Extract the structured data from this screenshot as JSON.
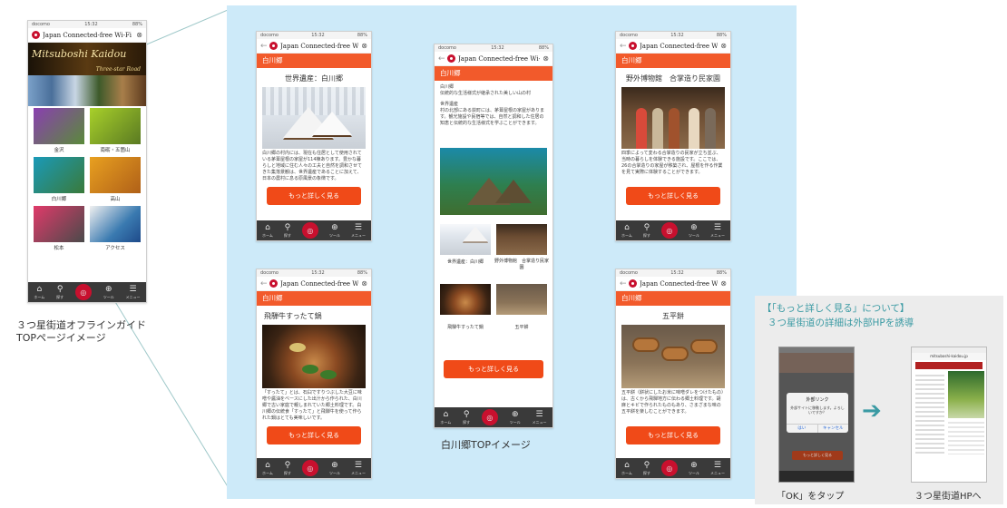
{
  "status_bar": {
    "carrier": "docomo",
    "time": "15:32",
    "battery": "88%"
  },
  "app": {
    "title": "Japan Connected-free Wi-Fi",
    "more_label": "もっと詳しく見る"
  },
  "tabbar": {
    "home": "ホーム",
    "search": "探す",
    "center": "宿泊",
    "tools": "ツール",
    "menu": "メニュー"
  },
  "guide": {
    "banner_title": "Mitsuboshi Kaidou",
    "banner_sub": "Three-star Road",
    "tiles": [
      "金沢",
      "南砺・五箇山",
      "白川郷",
      "高山",
      "松本",
      "アクセス"
    ],
    "caption_line1": "３つ星街道オフラインガイド",
    "caption_line2": "TOPページイメージ"
  },
  "shirakawa_top": {
    "crumb": "白川郷",
    "heading": "白川郷",
    "subheading": "伝統的な生活様式が継承された美しい山の村",
    "body_title": "世界遺産",
    "body": "村の北部にある荻町には、茅葺屋根の家屋があります。観光施設や民宿等では、自然と調和した住居の知恵と伝統的な生活様式を学ぶことができます。",
    "thumbs": [
      "世界遺産：白川郷",
      "野外博物館　合掌造り民家園",
      "飛騨牛すったて鍋",
      "五平餅"
    ],
    "caption": "白川郷TOPイメージ"
  },
  "pages": {
    "world_heritage": {
      "crumb": "白川郷",
      "title": "世界遺産：白川郷",
      "text": "白川郷の村内には、現在も住居として使用されている茅葺屋根の家屋が114棟あります。豊かな暮らしと地域に住む人々の工夫と自然を調和させてきた集落景観は、世界遺産であることに加えて、日本の農村に息る原風景の象徴です。"
    },
    "museum": {
      "crumb": "白川郷",
      "title": "野外博物館　合掌造り民家園",
      "text": "四季によって変わる合掌造りの民家が立ち並ぶ、当時の暮らしを体験できる施設です。ここでは、26の合掌造りの家屋が移築され、屋根を作る作業を見て実際に体験することができます。"
    },
    "nabe": {
      "crumb": "白川郷",
      "title": "飛騨牛すったて鍋",
      "text": "「すったて」とは、石臼ですりつぶした大豆に味噌や醤油をベースにした出汁から作られた、白川郷で古い家庭で親しまれていた郷土料理です。白川郷の伝統食「すったて」と飛騨牛を使って作られた鍋はとても美味しいです。"
    },
    "gohei": {
      "crumb": "白川郷",
      "title": "五平餅",
      "text": "五平餅（餅状にしたお米に味噌ダレをつけたもの）は、古くから飛騨地方に伝わる郷土料理です。胡麻とキビで作られたものもあり、さまざまな味の五平餅を楽しむことができます。"
    }
  },
  "note": {
    "title": "【「もっと詳しく見る」について】",
    "subtitle": "３つ星街道の詳細は外部HPを誘導",
    "dialog_title": "外部リンク",
    "dialog_body": "外部サイトに移動します。よろしいですか？",
    "dialog_ok": "はい",
    "dialog_cancel": "キャンセル",
    "caption_left": "「OK」をタップ",
    "caption_right": "３つ星街道HPへ",
    "url": "mitsuboshi-kaidou.jp"
  },
  "colors": {
    "panel": "#cdeaf9",
    "accent": "#f25a2b",
    "button": "#f04a18",
    "tabbar": "#3a3a3a",
    "connector": "#3a3a3a",
    "arrow": "#3a9aa3"
  }
}
